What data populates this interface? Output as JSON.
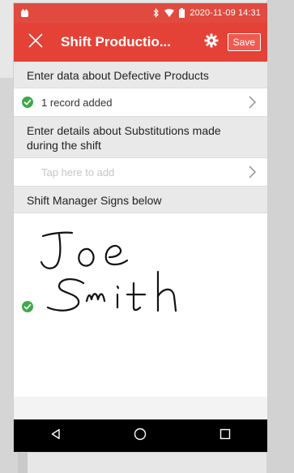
{
  "status_bar": {
    "datetime": "2020-11-09 14:31",
    "icons": [
      "app-notification-icon",
      "bluetooth-icon",
      "wifi-icon",
      "battery-icon"
    ]
  },
  "toolbar": {
    "title": "Shift Productio...",
    "close_icon": "close-icon",
    "settings_icon": "gear-icon",
    "save_label": "Save"
  },
  "defective_section": {
    "header": "Enter data about Defective Products",
    "row_text": "1 record added",
    "status_icon": "check-circle-icon"
  },
  "substitutions_section": {
    "header": "Enter details about Substitutions made during the shift",
    "row_text": "Tap here to add"
  },
  "signature_section": {
    "header": "Shift Manager Signs below",
    "status_icon": "check-circle-icon",
    "signature_line_1": "Joe",
    "signature_line_2": "Smith"
  },
  "nav_bar": {
    "buttons": [
      "back-icon",
      "home-icon",
      "recents-icon"
    ]
  },
  "colors": {
    "accent": "#e54237",
    "status_bar": "#e14a3f",
    "success_green": "#3fa84a",
    "background": "#e9e9e9"
  }
}
